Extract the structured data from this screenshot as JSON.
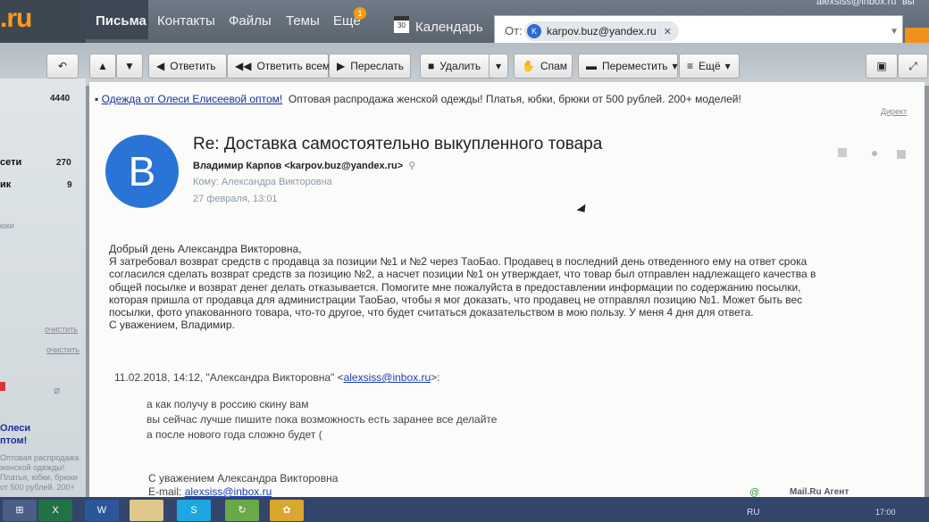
{
  "header": {
    "logo_text": ".ru",
    "nav": [
      "Письма",
      "Контакты",
      "Файлы",
      "Темы",
      "Ещё"
    ],
    "badge": "1",
    "calendar_icon_day": "30",
    "calendar_label": "Календарь",
    "user_email": "alexsiss@inbox.ru",
    "user_exit": "вы"
  },
  "search": {
    "prefix": "От:",
    "chip_avatar": "K",
    "chip_email": "karpov.buz@yandex.ru"
  },
  "toolbar": {
    "reply": "Ответить",
    "reply_all": "Ответить всем",
    "forward": "Переслать",
    "delete": "Удалить",
    "spam": "Спам",
    "move": "Переместить",
    "more": "Ещё"
  },
  "sidebar": {
    "count_top": "4440",
    "items": [
      {
        "label": "сети",
        "count": "270"
      },
      {
        "label": "ик",
        "count": "9"
      }
    ],
    "misc": "юки",
    "clear_1": "очистить",
    "clear_2": "очистить",
    "ad_title": "Олеси",
    "ad_title_2": "птом!",
    "ad_text": [
      "Оптовая распродажа",
      "женской одежды!",
      "Платья, юбки, брюки",
      "от 500 рублей. 200+"
    ]
  },
  "ad": {
    "link": "Одежда от Олеси Елисеевой оптом!",
    "text": "Оптовая распродажа женской одежды! Платья, юбки, брюки от 500 рублей. 200+ моделей!",
    "direct": "Директ"
  },
  "message": {
    "avatar_letter": "В",
    "subject": "Re: Доставка самостоятельно выкупленного товара",
    "from": "Владимир Карпов <karpov.buz@yandex.ru>",
    "to": "Кому: Александра Викторовна",
    "date": "27 февраля, 13:01",
    "body": [
      "Добрый день Александра Викторовна,",
      "Я затребовал возврат средств с продавца за позиции №1 и №2 через ТаоБао. Продавец в последний день отведенного ему на ответ срока",
      "согласился сделать возврат средств за позицию №2, а насчет позиции №1 он утверждает, что товар был отправлен надлежащего качества в",
      "общей посылке и возврат денег делать отказывается. Помогите мне пожалуйста в предоставлении информации по содержанию посылки,",
      "которая пришла от продавца для администрации ТаоБао, чтобы я мог доказать, что продавец не отправлял позицию №1. Может быть вес",
      "посылки, фото упакованного товара, что-то другое, что будет считаться доказательством в мою пользу. У меня 4 дня для ответа.",
      "С уважением, Владимир."
    ],
    "quote_head_pre": "11.02.2018, 14:12, \"Александра Викторовна\" <",
    "quote_head_link": "alexsiss@inbox.ru",
    "quote_head_post": ">:",
    "quote_lines": [
      "а как получу в россию скину вам",
      "вы сейчас лучше пишите пока возможность есть заранее все делайте",
      "а после нового года сложно будет ("
    ],
    "sig_line": "С уважением Александра Викторовна",
    "sig_email_label": "E-mail:",
    "sig_email": "alexsiss@inbox.ru"
  },
  "agent": {
    "icon": "@",
    "label": "Mail.Ru Агент"
  },
  "taskbar": {
    "excel": "X",
    "word": "W",
    "skype": "S",
    "lang": "RU",
    "time": "17:00"
  },
  "colors": {
    "accent": "#f0921a",
    "avatar": "#2a74d5",
    "link": "#1a3fb0"
  }
}
